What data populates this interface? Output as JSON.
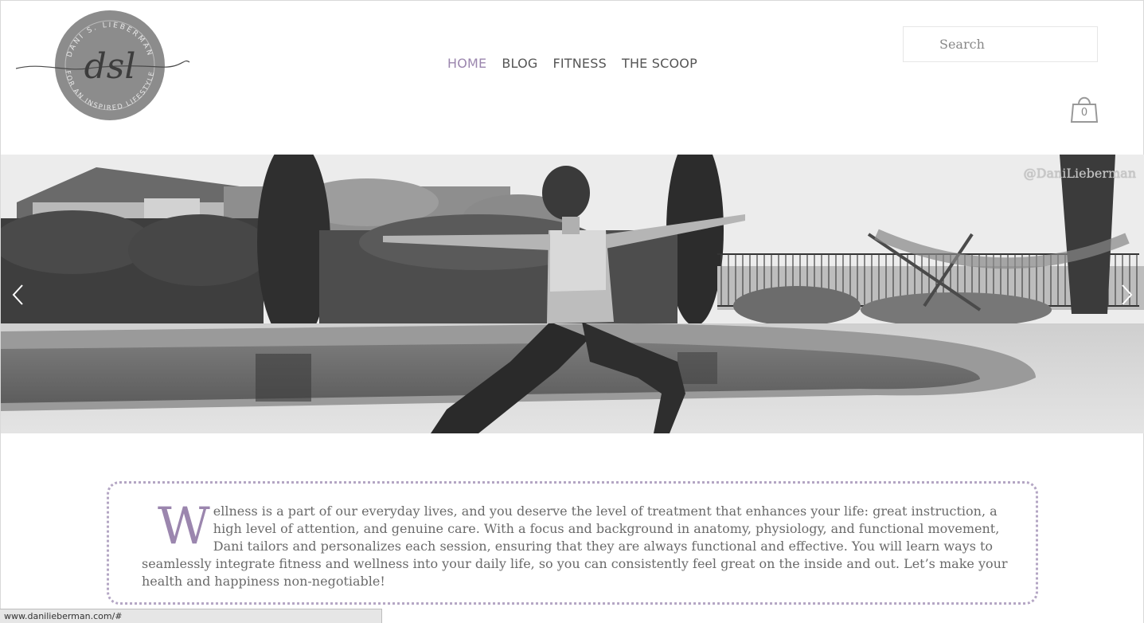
{
  "logo": {
    "monogram": "dsl",
    "ring_top": "DANI S. LIEBERMAN",
    "ring_bottom": "FOR AN INSPIRED LIFESTYLE"
  },
  "nav": {
    "items": [
      {
        "label": "HOME",
        "active": true
      },
      {
        "label": "BLOG",
        "active": false
      },
      {
        "label": "FITNESS",
        "active": false
      },
      {
        "label": "THE SCOOP",
        "active": false
      }
    ]
  },
  "search": {
    "placeholder": "Search"
  },
  "cart": {
    "count": "0",
    "icon": "shopping-bag-icon"
  },
  "hero": {
    "watermark": "@DaniLieberman",
    "prev_icon": "chevron-left-icon",
    "next_icon": "chevron-right-icon"
  },
  "intro": {
    "dropcap": "W",
    "body": "ellness is a part of our everyday lives, and you deserve the level of treatment that enhances your life: great instruction, a high level of attention, and genuine care. With a focus and background in anatomy, physiology, and functional movement, Dani tailors and personalizes each session, ensuring that they are always functional and effective. You will learn ways to seamlessly integrate fitness and wellness into your daily life, so you can consistently feel great on the inside and out. Let’s make your health and happiness non-negotiable!"
  },
  "statusbar": {
    "url": "www.danilieberman.com/#"
  },
  "colors": {
    "accent": "#9b86ae",
    "nav_text": "#555555",
    "intro_border": "#b4a6c4",
    "body_text": "#6a6a6a"
  }
}
